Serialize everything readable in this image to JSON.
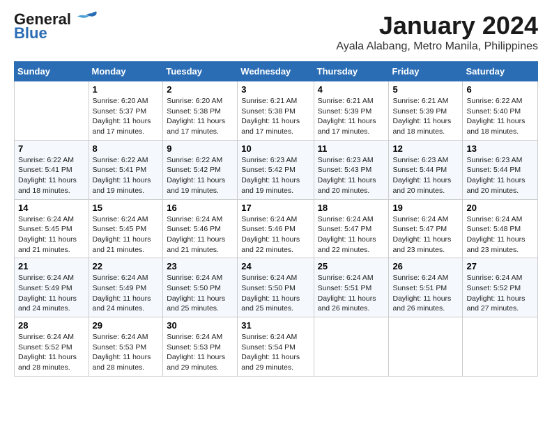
{
  "logo": {
    "line1": "General",
    "line2": "Blue"
  },
  "title": "January 2024",
  "subtitle": "Ayala Alabang, Metro Manila, Philippines",
  "days_of_week": [
    "Sunday",
    "Monday",
    "Tuesday",
    "Wednesday",
    "Thursday",
    "Friday",
    "Saturday"
  ],
  "weeks": [
    [
      {
        "day": "",
        "info": ""
      },
      {
        "day": "1",
        "info": "Sunrise: 6:20 AM\nSunset: 5:37 PM\nDaylight: 11 hours and 17 minutes."
      },
      {
        "day": "2",
        "info": "Sunrise: 6:20 AM\nSunset: 5:38 PM\nDaylight: 11 hours and 17 minutes."
      },
      {
        "day": "3",
        "info": "Sunrise: 6:21 AM\nSunset: 5:38 PM\nDaylight: 11 hours and 17 minutes."
      },
      {
        "day": "4",
        "info": "Sunrise: 6:21 AM\nSunset: 5:39 PM\nDaylight: 11 hours and 17 minutes."
      },
      {
        "day": "5",
        "info": "Sunrise: 6:21 AM\nSunset: 5:39 PM\nDaylight: 11 hours and 18 minutes."
      },
      {
        "day": "6",
        "info": "Sunrise: 6:22 AM\nSunset: 5:40 PM\nDaylight: 11 hours and 18 minutes."
      }
    ],
    [
      {
        "day": "7",
        "info": "Sunrise: 6:22 AM\nSunset: 5:41 PM\nDaylight: 11 hours and 18 minutes."
      },
      {
        "day": "8",
        "info": "Sunrise: 6:22 AM\nSunset: 5:41 PM\nDaylight: 11 hours and 19 minutes."
      },
      {
        "day": "9",
        "info": "Sunrise: 6:22 AM\nSunset: 5:42 PM\nDaylight: 11 hours and 19 minutes."
      },
      {
        "day": "10",
        "info": "Sunrise: 6:23 AM\nSunset: 5:42 PM\nDaylight: 11 hours and 19 minutes."
      },
      {
        "day": "11",
        "info": "Sunrise: 6:23 AM\nSunset: 5:43 PM\nDaylight: 11 hours and 20 minutes."
      },
      {
        "day": "12",
        "info": "Sunrise: 6:23 AM\nSunset: 5:44 PM\nDaylight: 11 hours and 20 minutes."
      },
      {
        "day": "13",
        "info": "Sunrise: 6:23 AM\nSunset: 5:44 PM\nDaylight: 11 hours and 20 minutes."
      }
    ],
    [
      {
        "day": "14",
        "info": "Sunrise: 6:24 AM\nSunset: 5:45 PM\nDaylight: 11 hours and 21 minutes."
      },
      {
        "day": "15",
        "info": "Sunrise: 6:24 AM\nSunset: 5:45 PM\nDaylight: 11 hours and 21 minutes."
      },
      {
        "day": "16",
        "info": "Sunrise: 6:24 AM\nSunset: 5:46 PM\nDaylight: 11 hours and 21 minutes."
      },
      {
        "day": "17",
        "info": "Sunrise: 6:24 AM\nSunset: 5:46 PM\nDaylight: 11 hours and 22 minutes."
      },
      {
        "day": "18",
        "info": "Sunrise: 6:24 AM\nSunset: 5:47 PM\nDaylight: 11 hours and 22 minutes."
      },
      {
        "day": "19",
        "info": "Sunrise: 6:24 AM\nSunset: 5:47 PM\nDaylight: 11 hours and 23 minutes."
      },
      {
        "day": "20",
        "info": "Sunrise: 6:24 AM\nSunset: 5:48 PM\nDaylight: 11 hours and 23 minutes."
      }
    ],
    [
      {
        "day": "21",
        "info": "Sunrise: 6:24 AM\nSunset: 5:49 PM\nDaylight: 11 hours and 24 minutes."
      },
      {
        "day": "22",
        "info": "Sunrise: 6:24 AM\nSunset: 5:49 PM\nDaylight: 11 hours and 24 minutes."
      },
      {
        "day": "23",
        "info": "Sunrise: 6:24 AM\nSunset: 5:50 PM\nDaylight: 11 hours and 25 minutes."
      },
      {
        "day": "24",
        "info": "Sunrise: 6:24 AM\nSunset: 5:50 PM\nDaylight: 11 hours and 25 minutes."
      },
      {
        "day": "25",
        "info": "Sunrise: 6:24 AM\nSunset: 5:51 PM\nDaylight: 11 hours and 26 minutes."
      },
      {
        "day": "26",
        "info": "Sunrise: 6:24 AM\nSunset: 5:51 PM\nDaylight: 11 hours and 26 minutes."
      },
      {
        "day": "27",
        "info": "Sunrise: 6:24 AM\nSunset: 5:52 PM\nDaylight: 11 hours and 27 minutes."
      }
    ],
    [
      {
        "day": "28",
        "info": "Sunrise: 6:24 AM\nSunset: 5:52 PM\nDaylight: 11 hours and 28 minutes."
      },
      {
        "day": "29",
        "info": "Sunrise: 6:24 AM\nSunset: 5:53 PM\nDaylight: 11 hours and 28 minutes."
      },
      {
        "day": "30",
        "info": "Sunrise: 6:24 AM\nSunset: 5:53 PM\nDaylight: 11 hours and 29 minutes."
      },
      {
        "day": "31",
        "info": "Sunrise: 6:24 AM\nSunset: 5:54 PM\nDaylight: 11 hours and 29 minutes."
      },
      {
        "day": "",
        "info": ""
      },
      {
        "day": "",
        "info": ""
      },
      {
        "day": "",
        "info": ""
      }
    ]
  ]
}
